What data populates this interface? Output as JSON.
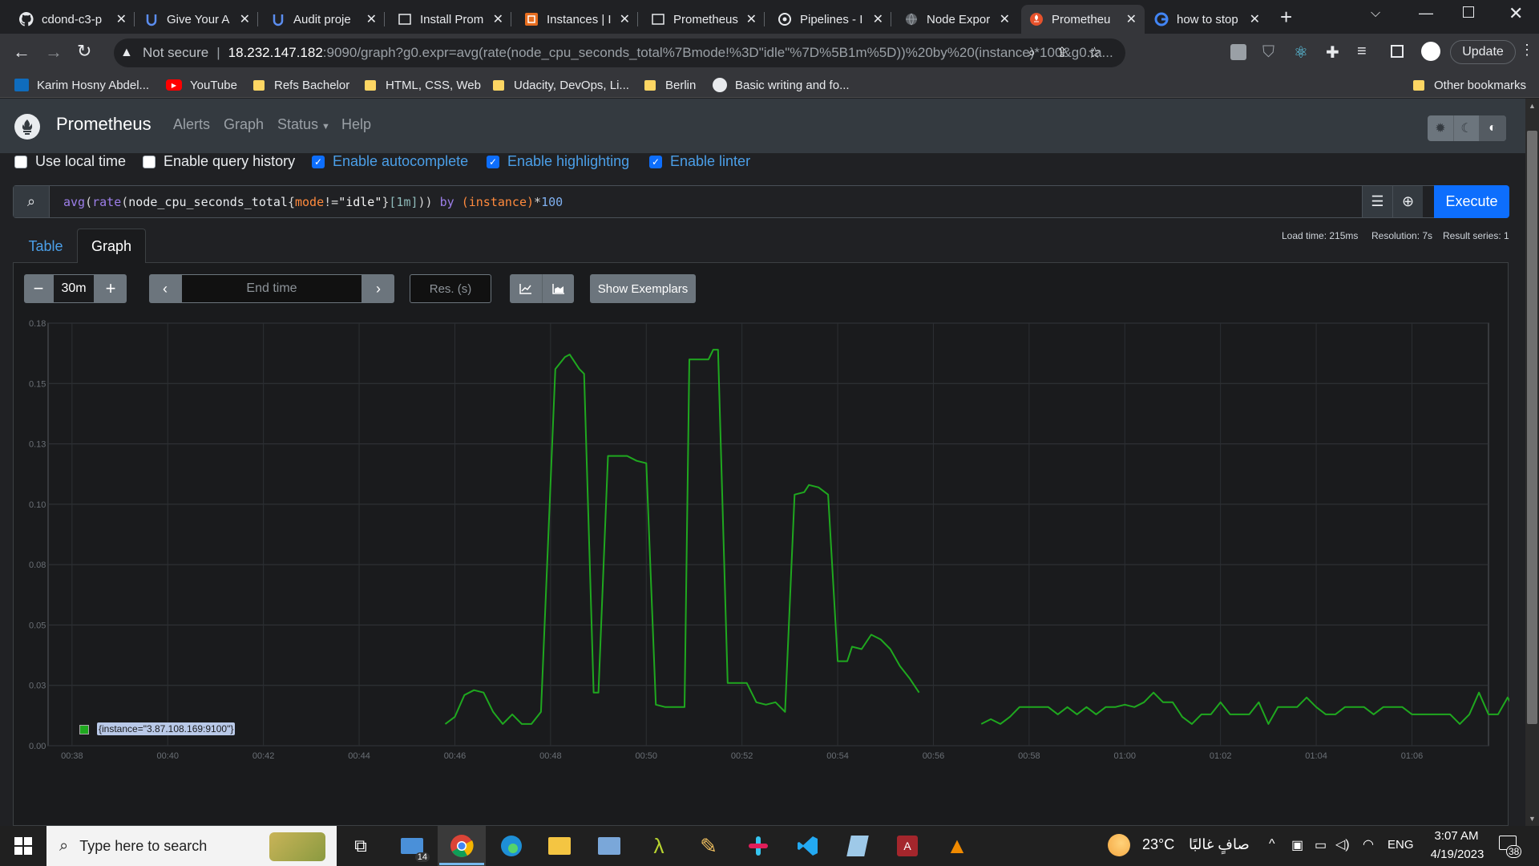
{
  "browser": {
    "tabs": [
      {
        "title": "cdond-c3-p",
        "icon": "github-icon"
      },
      {
        "title": "Give Your A",
        "icon": "udacity-icon"
      },
      {
        "title": "Audit proje",
        "icon": "udacity-icon"
      },
      {
        "title": "Install Prom",
        "icon": "page-icon"
      },
      {
        "title": "Instances | I",
        "icon": "aws-icon"
      },
      {
        "title": "Prometheus",
        "icon": "page-icon"
      },
      {
        "title": "Pipelines - I",
        "icon": "circleci-icon"
      },
      {
        "title": "Node Expor",
        "icon": "globe-icon"
      },
      {
        "title": "Prometheu",
        "icon": "prometheus-icon"
      },
      {
        "title": "how to stop",
        "icon": "google-icon"
      }
    ],
    "new_tab": "+",
    "security_label": "Not secure",
    "url_host": "18.232.147.182",
    "url_rest": ":9090/graph?g0.expr=avg(rate(node_cpu_seconds_total%7Bmode!%3D\"idle\"%7D%5B1m%5D))%20by%20(instance)*100&g0.ta...",
    "update_label": "Update",
    "bookmarks": [
      {
        "label": "Karim Hosny Abdel...",
        "icon": "outlook-icon"
      },
      {
        "label": "YouTube",
        "icon": "youtube-icon"
      },
      {
        "label": "Refs Bachelor",
        "icon": "folder-icon"
      },
      {
        "label": "HTML, CSS, Web",
        "icon": "folder-icon"
      },
      {
        "label": "Udacity, DevOps, Li...",
        "icon": "folder-icon"
      },
      {
        "label": "Berlin",
        "icon": "folder-icon"
      },
      {
        "label": "Basic writing and fo...",
        "icon": "github-icon"
      }
    ],
    "other_bookmarks": "Other bookmarks"
  },
  "prometheus": {
    "brand": "Prometheus",
    "nav": [
      "Alerts",
      "Graph",
      "Status",
      "Help"
    ],
    "options": [
      {
        "label": "Use local time",
        "checked": false
      },
      {
        "label": "Enable query history",
        "checked": false
      },
      {
        "label": "Enable autocomplete",
        "checked": true
      },
      {
        "label": "Enable highlighting",
        "checked": true
      },
      {
        "label": "Enable linter",
        "checked": true
      }
    ],
    "query": {
      "fn1": "avg",
      "p1": "(",
      "fn2": "rate",
      "p2": "(",
      "metric": "node_cpu_seconds_total",
      "b1": "{",
      "label": "mode",
      "op": "!=",
      "str": "\"idle\"",
      "b2": "}",
      "range": "[1m]",
      "p3": "))",
      "by": " by ",
      "grp": "(instance)",
      "mul": "*",
      "num": "100"
    },
    "execute_label": "Execute",
    "stats": {
      "load_time": "Load time: 215ms",
      "resolution": "Resolution: 7s",
      "result_series": "Result series: 1"
    },
    "tabs": [
      "Table",
      "Graph"
    ],
    "active_tab": "Graph",
    "controls": {
      "range": "30m",
      "end_time_placeholder": "End time",
      "res_placeholder": "Res. (s)",
      "show_exemplars": "Show Exemplars"
    },
    "legend": "{instance=\"3.87.108.169:9100\"}",
    "series_color": "#1fa81f"
  },
  "chart_data": {
    "type": "line",
    "x_ticks": [
      "00:38",
      "00:40",
      "00:42",
      "00:44",
      "00:46",
      "00:48",
      "00:50",
      "00:52",
      "00:54",
      "00:56",
      "00:58",
      "01:00",
      "01:02",
      "01:04",
      "01:06"
    ],
    "y_ticks": [
      "0.18",
      "0.15",
      "0.13",
      "0.10",
      "0.08",
      "0.05",
      "0.03",
      "0.00"
    ],
    "ylim": [
      0,
      0.175
    ],
    "xlim_minutes": [
      37.5,
      67.6
    ],
    "grid": true,
    "series": [
      {
        "name": "{instance=\"3.87.108.169:9100\"}",
        "segments": [
          [
            [
              45.8,
              0.009
            ],
            [
              46.0,
              0.012
            ],
            [
              46.2,
              0.021
            ],
            [
              46.4,
              0.023
            ],
            [
              46.6,
              0.022
            ],
            [
              46.8,
              0.014
            ],
            [
              47.0,
              0.009
            ],
            [
              47.2,
              0.013
            ],
            [
              47.4,
              0.009
            ],
            [
              47.6,
              0.009
            ],
            [
              47.8,
              0.014
            ],
            [
              48.1,
              0.156
            ],
            [
              48.3,
              0.161
            ],
            [
              48.4,
              0.162
            ],
            [
              48.6,
              0.156
            ],
            [
              48.7,
              0.154
            ],
            [
              48.9,
              0.022
            ],
            [
              49.0,
              0.022
            ],
            [
              49.2,
              0.12
            ],
            [
              49.4,
              0.12
            ],
            [
              49.6,
              0.12
            ],
            [
              49.8,
              0.118
            ],
            [
              50.0,
              0.117
            ],
            [
              50.2,
              0.017
            ],
            [
              50.4,
              0.016
            ],
            [
              50.6,
              0.016
            ],
            [
              50.8,
              0.016
            ],
            [
              50.9,
              0.16
            ],
            [
              51.1,
              0.16
            ],
            [
              51.3,
              0.16
            ],
            [
              51.4,
              0.164
            ],
            [
              51.5,
              0.164
            ],
            [
              51.7,
              0.026
            ],
            [
              51.9,
              0.026
            ],
            [
              52.1,
              0.026
            ],
            [
              52.3,
              0.018
            ],
            [
              52.5,
              0.017
            ],
            [
              52.7,
              0.018
            ],
            [
              52.9,
              0.014
            ],
            [
              53.1,
              0.104
            ],
            [
              53.3,
              0.105
            ],
            [
              53.4,
              0.108
            ],
            [
              53.6,
              0.107
            ],
            [
              53.8,
              0.104
            ],
            [
              54.0,
              0.035
            ],
            [
              54.2,
              0.035
            ],
            [
              54.3,
              0.041
            ],
            [
              54.5,
              0.04
            ],
            [
              54.7,
              0.046
            ],
            [
              54.9,
              0.044
            ],
            [
              55.1,
              0.04
            ],
            [
              55.3,
              0.033
            ],
            [
              55.5,
              0.028
            ],
            [
              55.7,
              0.022
            ]
          ],
          [
            [
              57.0,
              0.009
            ],
            [
              57.2,
              0.011
            ],
            [
              57.4,
              0.009
            ],
            [
              57.6,
              0.012
            ],
            [
              57.8,
              0.016
            ],
            [
              58.0,
              0.016
            ],
            [
              58.2,
              0.016
            ],
            [
              58.4,
              0.016
            ],
            [
              58.6,
              0.013
            ],
            [
              58.8,
              0.016
            ],
            [
              59.0,
              0.013
            ],
            [
              59.2,
              0.016
            ],
            [
              59.4,
              0.013
            ],
            [
              59.6,
              0.016
            ],
            [
              59.8,
              0.016
            ],
            [
              60.0,
              0.017
            ],
            [
              60.2,
              0.016
            ],
            [
              60.4,
              0.018
            ],
            [
              60.6,
              0.022
            ],
            [
              60.8,
              0.018
            ],
            [
              61.0,
              0.018
            ],
            [
              61.2,
              0.012
            ],
            [
              61.4,
              0.009
            ],
            [
              61.6,
              0.013
            ],
            [
              61.8,
              0.013
            ],
            [
              62.0,
              0.018
            ],
            [
              62.2,
              0.013
            ],
            [
              62.4,
              0.013
            ],
            [
              62.6,
              0.013
            ],
            [
              62.8,
              0.018
            ],
            [
              63.0,
              0.009
            ],
            [
              63.2,
              0.016
            ],
            [
              63.4,
              0.016
            ],
            [
              63.6,
              0.016
            ],
            [
              63.8,
              0.02
            ],
            [
              64.0,
              0.016
            ],
            [
              64.2,
              0.013
            ],
            [
              64.4,
              0.013
            ],
            [
              64.6,
              0.016
            ],
            [
              64.8,
              0.016
            ],
            [
              65.0,
              0.016
            ],
            [
              65.2,
              0.013
            ],
            [
              65.4,
              0.016
            ],
            [
              65.6,
              0.016
            ],
            [
              65.8,
              0.016
            ],
            [
              66.0,
              0.013
            ],
            [
              66.2,
              0.013
            ],
            [
              66.4,
              0.013
            ],
            [
              66.6,
              0.013
            ],
            [
              66.8,
              0.013
            ],
            [
              67.0,
              0.009
            ],
            [
              67.2,
              0.013
            ],
            [
              67.4,
              0.022
            ],
            [
              67.6,
              0.013
            ],
            [
              67.8,
              0.013
            ],
            [
              68.0,
              0.02
            ],
            [
              68.2,
              0.013
            ]
          ]
        ]
      }
    ]
  },
  "taskbar": {
    "search_placeholder": "Type here to search",
    "mail_badge": "14",
    "weather": "23°C",
    "weather_text": "صافٍ غالبًا",
    "lang": "ENG",
    "time": "3:07 AM",
    "date": "4/19/2023",
    "notif_count": "38"
  }
}
